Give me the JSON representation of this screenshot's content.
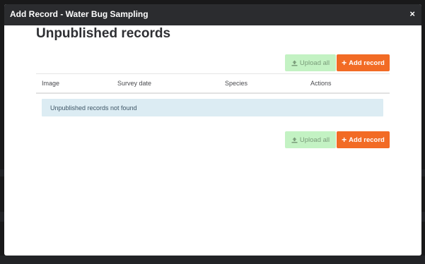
{
  "modal": {
    "title": "Add Record - Water Bug Sampling",
    "close_glyph": "×"
  },
  "page": {
    "title": "Unpublished records"
  },
  "toolbar_top": {
    "upload_label": "Upload all",
    "add_label": "Add record"
  },
  "table": {
    "columns": [
      "Image",
      "Survey date",
      "Species",
      "Actions"
    ],
    "empty_message": "Unpublished records not found"
  },
  "toolbar_bottom": {
    "upload_label": "Upload all",
    "add_label": "Add record"
  },
  "icons": {
    "upload": "upload-icon",
    "plus": "plus-icon",
    "close": "close-icon"
  },
  "colors": {
    "header_bg": "#2b2c2f",
    "upload_button_bg": "#c3f2c3",
    "add_button_bg": "#f26b25",
    "alert_bg": "#dcecf3"
  }
}
